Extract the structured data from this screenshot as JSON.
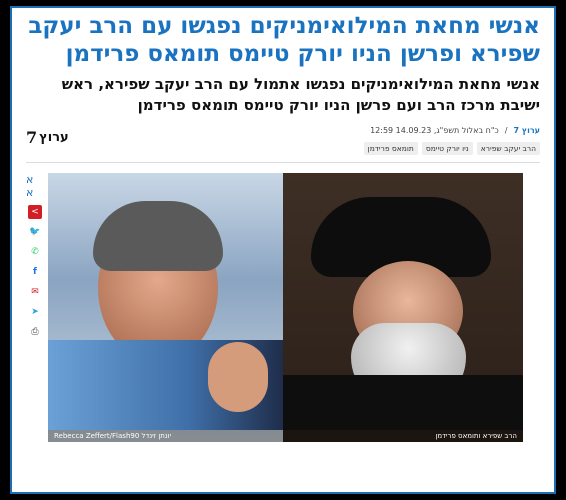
{
  "article": {
    "title": "אנשי מחאת המילואימניקים נפגשו עם הרב יעקב שפירא ופרשן הניו יורק טיימס תומאס פרידמן",
    "subtitle": "אנשי מחאת המילואימניקים נפגשו אתמול עם הרב יעקב שפירא, ראש ישיבת מרכז הרב ועם פרשן הניו יורק טיימס תומאס פרידמן",
    "source_label": "ערוץ 7",
    "date_text": "כ\"ח באלול תשפ\"ג, 14.09.23 12:59",
    "tags": [
      "הרב יעקב שפירא",
      "ניו יורק טיימס",
      "תומאס פרידמן"
    ]
  },
  "logo": {
    "number": "7",
    "word": "ערוץ"
  },
  "share": {
    "font_size_label": "א א",
    "icons": [
      "share-icon",
      "twitter-icon",
      "whatsapp-icon",
      "facebook-icon",
      "email-icon",
      "telegram-icon",
      "print-icon"
    ]
  },
  "image": {
    "caption_left": "Rebecca Zeffert/Flash90 יונתן זינדל",
    "caption_right": "הרב שפירא ותומאס פרידמן"
  },
  "colors": {
    "accent": "#1a73c0",
    "share_main": "#d21f26",
    "frame_border": "#1b6fb6"
  }
}
